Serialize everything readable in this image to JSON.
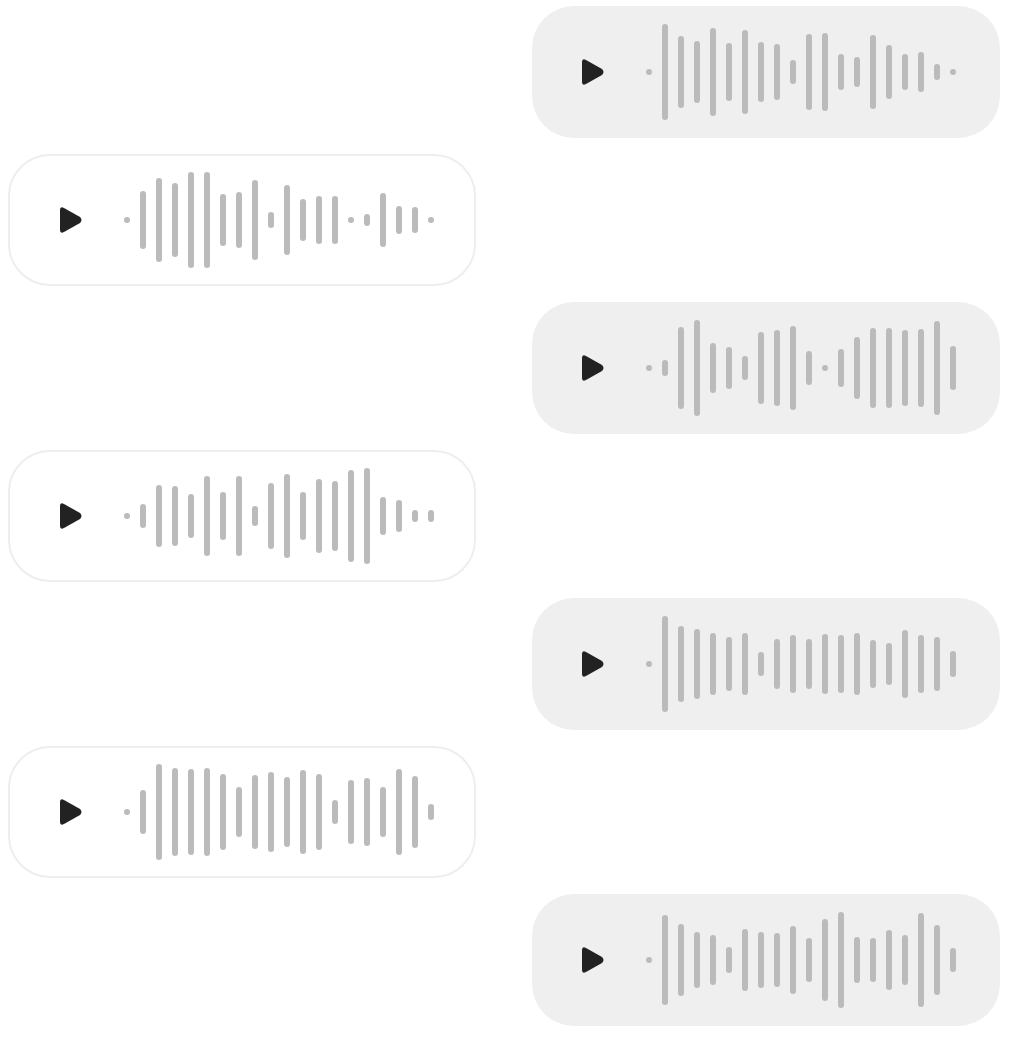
{
  "messages": [
    {
      "kind": "outgoing"
    },
    {
      "kind": "incoming"
    },
    {
      "kind": "outgoing"
    },
    {
      "kind": "incoming"
    },
    {
      "kind": "outgoing"
    },
    {
      "kind": "incoming"
    },
    {
      "kind": "outgoing"
    }
  ]
}
